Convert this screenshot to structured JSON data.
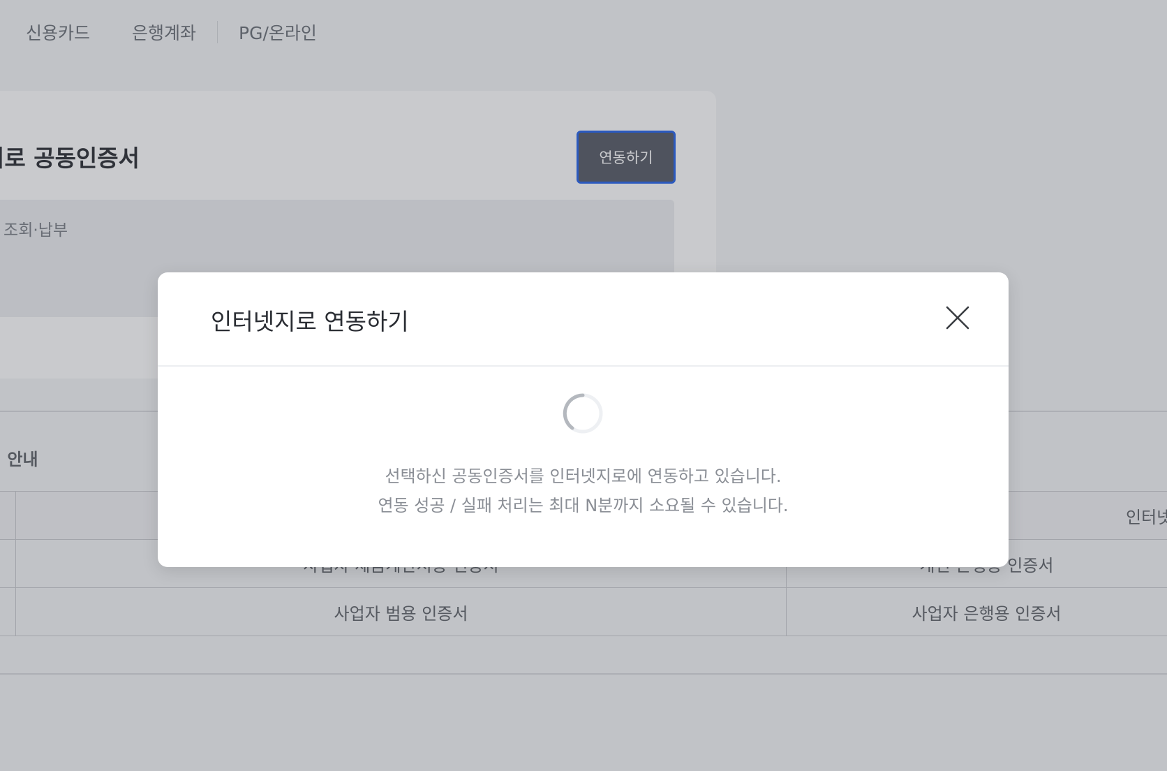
{
  "tabs": [
    {
      "label": "신용카드"
    },
    {
      "label": "은행계좌"
    },
    {
      "label": "PG/온라인"
    }
  ],
  "card": {
    "title": "지로 공동인증서",
    "link_button_label": "연동하기",
    "info_text": "| 조회·납부"
  },
  "section": {
    "title": "서 안내"
  },
  "table": {
    "header_right": "인터넷",
    "rows": [
      {
        "left": "사업자 세금계산서용 인증서",
        "right": "개인 은행용 인증서"
      },
      {
        "left": "사업자 범용 인증서",
        "right": "사업자 은행용 인증서"
      }
    ]
  },
  "modal": {
    "title": "인터넷지로 연동하기",
    "message_line1": "선택하신 공동인증서를 인터넷지로에 연동하고 있습니다.",
    "message_line2": "연동 성공 / 실패 처리는 최대 N분까지 소요될 수 있습니다.",
    "close_icon": "close-icon",
    "spinner_icon": "loading-spinner-icon"
  },
  "colors": {
    "accent_border": "#2563eb",
    "button_bg": "#565a66",
    "overlay": "rgba(60,65,74,0.28)"
  }
}
